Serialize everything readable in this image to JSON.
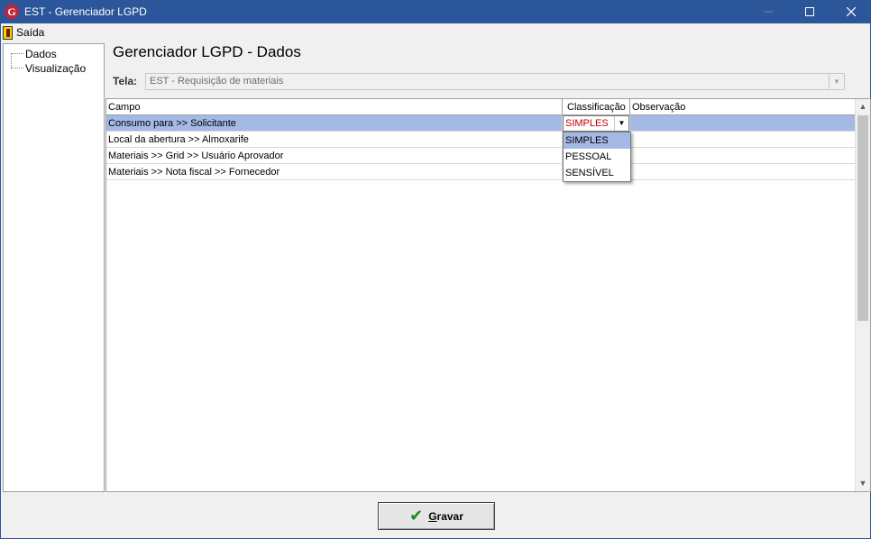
{
  "window": {
    "title": "EST - Gerenciador LGPD",
    "app_icon_letter": "G",
    "minimize_icon": "minimize-icon",
    "maximize_icon": "maximize-icon",
    "close_icon": "close-icon"
  },
  "menu": {
    "exit_label": "Saída"
  },
  "sidebar": {
    "items": [
      {
        "label": "Dados"
      },
      {
        "label": "Visualização"
      }
    ]
  },
  "main": {
    "title": "Gerenciador LGPD - Dados",
    "tela_label": "Tela:",
    "tela_value": "EST - Requisição de materiais"
  },
  "grid": {
    "columns": [
      "Campo",
      "Classificação",
      "Observação"
    ],
    "rows": [
      {
        "campo": "Consumo para >> Solicitante",
        "classificacao": "",
        "observacao": ""
      },
      {
        "campo": "Local da abertura >> Almoxarife",
        "classificacao": "",
        "observacao": ""
      },
      {
        "campo": "Materiais >> Grid >> Usuário Aprovador",
        "classificacao": "",
        "observacao": ""
      },
      {
        "campo": "Materiais >> Nota fiscal >> Fornecedor",
        "classificacao": "",
        "observacao": ""
      }
    ],
    "editor_value": "SIMPLES",
    "dropdown_options": [
      "SIMPLES",
      "PESSOAL",
      "SENSÍVEL"
    ],
    "selected_option": "SIMPLES"
  },
  "footer": {
    "save_label_underlined": "G",
    "save_label_rest": "ravar"
  },
  "colors": {
    "titlebar": "#2b579a",
    "selection": "#a5b9e6",
    "editor_text": "#c00000",
    "check": "#1a8a1a"
  }
}
